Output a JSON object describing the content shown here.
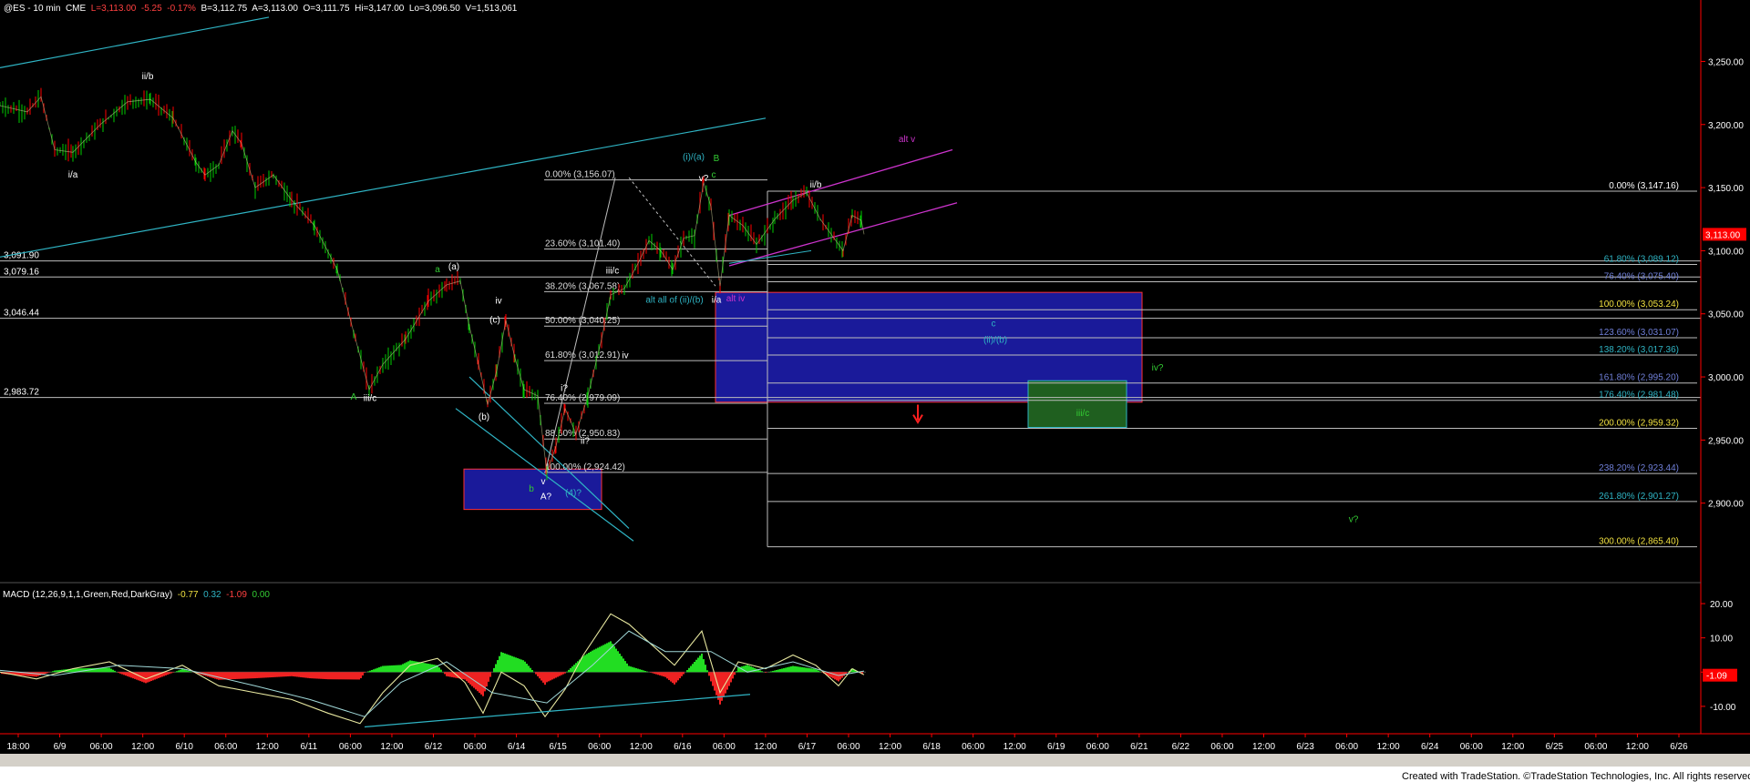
{
  "header": {
    "symbol": "@ES - 10 min  CME",
    "last": "L=3,113.00",
    "change": "-5.25",
    "pct": "-0.17%",
    "bid": "B=3,112.75",
    "ask": "A=3,113.00",
    "open": "O=3,111.75",
    "high": "Hi=3,147.00",
    "low": "Lo=3,096.50",
    "volume": "V=1,513,061"
  },
  "macd_header": {
    "label": "MACD (12,26,9,1,1,Green,Red,DarkGray)",
    "v1": "-0.77",
    "v2": "0.32",
    "v3": "-1.09",
    "v4": "0.00"
  },
  "footer": "Created with TradeStation. ©TradeStation Technologies, Inc. All rights reserved.",
  "colors": {
    "background": "#000000",
    "axis_panel": "#ffffff",
    "price_green": "#00cc00",
    "price_red": "#ff0000",
    "trend_cyan": "#2fb4c4",
    "channel_magenta": "#cc33cc",
    "box_blue": "#1a1a9a",
    "box_green": "#1f5f1f",
    "fib_line": "#bdbdbd"
  },
  "chart_data": {
    "type": "candlestick",
    "title": "",
    "price_axis": {
      "ticks": [
        "3,250.00",
        "3,200.00",
        "3,150.00",
        "3,100.00",
        "3,050.00",
        "3,000.00",
        "2,950.00",
        "2,900.00"
      ],
      "ylim": [
        2850,
        3290
      ],
      "last_price_label": "3,113.00"
    },
    "time_axis": {
      "ticks": [
        "18:00",
        "6/9",
        "06:00",
        "12:00",
        "6/10",
        "06:00",
        "12:00",
        "6/11",
        "06:00",
        "12:00",
        "6/12",
        "06:00",
        "6/14",
        "6/15",
        "06:00",
        "12:00",
        "6/16",
        "06:00",
        "12:00",
        "6/17",
        "06:00",
        "12:00",
        "6/18",
        "06:00",
        "12:00",
        "6/19",
        "06:00",
        "6/21",
        "6/22",
        "06:00",
        "12:00",
        "6/23",
        "06:00",
        "12:00",
        "6/24",
        "06:00",
        "12:00",
        "6/25",
        "06:00",
        "12:00",
        "6/26"
      ]
    },
    "price_path": [
      {
        "t": 0,
        "p": 3215
      },
      {
        "t": 30,
        "p": 3210
      },
      {
        "t": 45,
        "p": 3222
      },
      {
        "t": 60,
        "p": 3180
      },
      {
        "t": 80,
        "p": 3178
      },
      {
        "t": 110,
        "p": 3200
      },
      {
        "t": 140,
        "p": 3218
      },
      {
        "t": 165,
        "p": 3220
      },
      {
        "t": 190,
        "p": 3205
      },
      {
        "t": 215,
        "p": 3170
      },
      {
        "t": 225,
        "p": 3160
      },
      {
        "t": 240,
        "p": 3168
      },
      {
        "t": 255,
        "p": 3195
      },
      {
        "t": 265,
        "p": 3185
      },
      {
        "t": 280,
        "p": 3150
      },
      {
        "t": 300,
        "p": 3160
      },
      {
        "t": 320,
        "p": 3140
      },
      {
        "t": 345,
        "p": 3120
      },
      {
        "t": 370,
        "p": 3085
      },
      {
        "t": 390,
        "p": 3030
      },
      {
        "t": 405,
        "p": 2990
      },
      {
        "t": 420,
        "p": 3010
      },
      {
        "t": 445,
        "p": 3030
      },
      {
        "t": 470,
        "p": 3060
      },
      {
        "t": 490,
        "p": 3073
      },
      {
        "t": 505,
        "p": 3076
      },
      {
        "t": 515,
        "p": 3040
      },
      {
        "t": 525,
        "p": 3010
      },
      {
        "t": 535,
        "p": 2978
      },
      {
        "t": 545,
        "p": 3005
      },
      {
        "t": 555,
        "p": 3045
      },
      {
        "t": 565,
        "p": 3015
      },
      {
        "t": 575,
        "p": 2990
      },
      {
        "t": 590,
        "p": 2985
      },
      {
        "t": 600,
        "p": 2924
      },
      {
        "t": 610,
        "p": 2945
      },
      {
        "t": 620,
        "p": 2975
      },
      {
        "t": 632,
        "p": 2955
      },
      {
        "t": 645,
        "p": 2985
      },
      {
        "t": 660,
        "p": 3030
      },
      {
        "t": 670,
        "p": 3065
      },
      {
        "t": 685,
        "p": 3070
      },
      {
        "t": 700,
        "p": 3090
      },
      {
        "t": 712,
        "p": 3108
      },
      {
        "t": 725,
        "p": 3100
      },
      {
        "t": 738,
        "p": 3085
      },
      {
        "t": 750,
        "p": 3110
      },
      {
        "t": 762,
        "p": 3112
      },
      {
        "t": 772,
        "p": 3154
      },
      {
        "t": 780,
        "p": 3135
      },
      {
        "t": 790,
        "p": 3072
      },
      {
        "t": 800,
        "p": 3128
      },
      {
        "t": 815,
        "p": 3120
      },
      {
        "t": 830,
        "p": 3105
      },
      {
        "t": 850,
        "p": 3125
      },
      {
        "t": 870,
        "p": 3140
      },
      {
        "t": 885,
        "p": 3146
      },
      {
        "t": 900,
        "p": 3125
      },
      {
        "t": 915,
        "p": 3110
      },
      {
        "t": 925,
        "p": 3100
      },
      {
        "t": 935,
        "p": 3128
      },
      {
        "t": 945,
        "p": 3124
      },
      {
        "t": 948,
        "p": 3113
      }
    ],
    "annotations": [
      {
        "text": "i/a",
        "t": 80,
        "p": 3158,
        "color": "#ffffff"
      },
      {
        "text": "ii/b",
        "t": 162,
        "p": 3236,
        "color": "#ffffff"
      },
      {
        "text": "A",
        "t": 388,
        "p": 2982,
        "color": "#33cc33"
      },
      {
        "text": "iii/c",
        "t": 406,
        "p": 2981,
        "color": "#ffffff"
      },
      {
        "text": "a",
        "t": 480,
        "p": 3083,
        "color": "#33cc33"
      },
      {
        "text": "(a)",
        "t": 498,
        "p": 3085,
        "color": "#ffffff"
      },
      {
        "text": "iv",
        "t": 547,
        "p": 3058,
        "color": "#ffffff"
      },
      {
        "text": "(c)",
        "t": 543,
        "p": 3043,
        "color": "#ffffff"
      },
      {
        "text": "(b)",
        "t": 531,
        "p": 2966,
        "color": "#ffffff"
      },
      {
        "text": "b",
        "t": 583,
        "p": 2909,
        "color": "#33cc33"
      },
      {
        "text": "v",
        "t": 596,
        "p": 2915,
        "color": "#ffffff"
      },
      {
        "text": "A?",
        "t": 599,
        "p": 2903,
        "color": "#ffffff"
      },
      {
        "text": "(4)?",
        "t": 629,
        "p": 2906,
        "color": "#2fb4c4"
      },
      {
        "text": "i?",
        "t": 619,
        "p": 2989,
        "color": "#ffffff"
      },
      {
        "text": "ii?",
        "t": 642,
        "p": 2947,
        "color": "#ffffff"
      },
      {
        "text": "iv",
        "t": 686,
        "p": 3015,
        "color": "#ffffff"
      },
      {
        "text": "iii/c",
        "t": 672,
        "p": 3082,
        "color": "#ffffff"
      },
      {
        "text": "alt all of (ii)/(b)",
        "t": 740,
        "p": 3059,
        "color": "#2fb4c4"
      },
      {
        "text": "i/a",
        "t": 786,
        "p": 3059,
        "color": "#ffffff"
      },
      {
        "text": "alt iv",
        "t": 807,
        "p": 3060,
        "color": "#cc33cc"
      },
      {
        "text": "(i)/(a)",
        "t": 761,
        "p": 3172,
        "color": "#2fb4c4"
      },
      {
        "text": "B",
        "t": 786,
        "p": 3171,
        "color": "#33cc33"
      },
      {
        "text": "v?",
        "t": 772,
        "p": 3155,
        "color": "#ffffff"
      },
      {
        "text": "c",
        "t": 783,
        "p": 3158,
        "color": "#33cc33"
      },
      {
        "text": "ii/b",
        "t": 895,
        "p": 3150,
        "color": "#ffffff"
      },
      {
        "text": "alt v",
        "t": 995,
        "p": 3186,
        "color": "#cc33cc"
      },
      {
        "text": "c",
        "t": 1090,
        "p": 3040,
        "color": "#2fb4c4"
      },
      {
        "text": "(ii)/(b)",
        "t": 1092,
        "p": 3027,
        "color": "#2fb4c4"
      },
      {
        "text": "iv?",
        "t": 1270,
        "p": 3005,
        "color": "#33cc33"
      },
      {
        "text": "iii/c",
        "t": 1188,
        "p": 2969,
        "color": "#33cc33"
      },
      {
        "text": "v?",
        "t": 1485,
        "p": 2885,
        "color": "#33cc33"
      }
    ],
    "left_levels": [
      {
        "label": "3,091.90",
        "price": 3091.9
      },
      {
        "label": "3,079.16",
        "price": 3079.16
      },
      {
        "label": "3,046.44",
        "price": 3046.44
      },
      {
        "label": "2,983.72",
        "price": 2983.72
      }
    ],
    "fib_retracement": [
      {
        "label": "0.00% (3,156.07)",
        "price": 3156.07
      },
      {
        "label": "23.60% (3,101.40)",
        "price": 3101.4
      },
      {
        "label": "38.20% (3,067.58)",
        "price": 3067.58
      },
      {
        "label": "50.00% (3,040.25)",
        "price": 3040.25
      },
      {
        "label": "61.80% (3,012.91)",
        "price": 3012.91
      },
      {
        "label": "76.40% (2,979.09)",
        "price": 2979.09
      },
      {
        "label": "88.60% (2,950.83)",
        "price": 2950.83
      },
      {
        "label": "100.00% (2,924.42)",
        "price": 2924.42
      }
    ],
    "fib_extension": [
      {
        "label": "0.00% (3,147.16)",
        "price": 3147.16,
        "color": "#ffffff"
      },
      {
        "label": "61.80% (3,089.12)",
        "price": 3089.12,
        "color": "#2fb4c4"
      },
      {
        "label": "76.40% (3,075.40)",
        "price": 3075.4,
        "color": "#6f7fd8"
      },
      {
        "label": "100.00% (3,053.24)",
        "price": 3053.24,
        "color": "#f0e040"
      },
      {
        "label": "123.60% (3,031.07)",
        "price": 3031.07,
        "color": "#6f7fd8"
      },
      {
        "label": "138.20% (3,017.36)",
        "price": 3017.36,
        "color": "#2fb4c4"
      },
      {
        "label": "161.80% (2,995.20)",
        "price": 2995.2,
        "color": "#6f7fd8"
      },
      {
        "label": "176.40% (2,981.48)",
        "price": 2981.48,
        "color": "#2fb4c4"
      },
      {
        "label": "200.00% (2,959.32)",
        "price": 2959.32,
        "color": "#f0e040"
      },
      {
        "label": "238.20% (2,923.44)",
        "price": 2923.44,
        "color": "#6f7fd8"
      },
      {
        "label": "261.80% (2,901.27)",
        "price": 2901.27,
        "color": "#2fb4c4"
      },
      {
        "label": "300.00% (2,865.40)",
        "price": 2865.4,
        "color": "#f0e040"
      }
    ],
    "macd": {
      "ticks": [
        "20.00",
        "10.00",
        "0.00",
        "-10.00"
      ],
      "ylim": [
        -18,
        24
      ],
      "last_value_label": "-1.09",
      "macd_line": [
        {
          "t": 0,
          "v": 0
        },
        {
          "t": 40,
          "v": -2
        },
        {
          "t": 80,
          "v": 1
        },
        {
          "t": 120,
          "v": 3
        },
        {
          "t": 160,
          "v": -2
        },
        {
          "t": 200,
          "v": 2
        },
        {
          "t": 240,
          "v": -4
        },
        {
          "t": 280,
          "v": -6
        },
        {
          "t": 320,
          "v": -8
        },
        {
          "t": 360,
          "v": -12
        },
        {
          "t": 395,
          "v": -15
        },
        {
          "t": 420,
          "v": -6
        },
        {
          "t": 450,
          "v": 2
        },
        {
          "t": 480,
          "v": 4
        },
        {
          "t": 510,
          "v": -3
        },
        {
          "t": 530,
          "v": -12
        },
        {
          "t": 550,
          "v": 0
        },
        {
          "t": 575,
          "v": -4
        },
        {
          "t": 598,
          "v": -13
        },
        {
          "t": 620,
          "v": -5
        },
        {
          "t": 640,
          "v": 5
        },
        {
          "t": 670,
          "v": 17
        },
        {
          "t": 690,
          "v": 14
        },
        {
          "t": 715,
          "v": 8
        },
        {
          "t": 740,
          "v": 2
        },
        {
          "t": 770,
          "v": 12
        },
        {
          "t": 790,
          "v": -6
        },
        {
          "t": 810,
          "v": 3
        },
        {
          "t": 840,
          "v": 1
        },
        {
          "t": 870,
          "v": 5
        },
        {
          "t": 895,
          "v": 2
        },
        {
          "t": 920,
          "v": -4
        },
        {
          "t": 935,
          "v": 1
        },
        {
          "t": 948,
          "v": -0.77
        }
      ],
      "signal_line": [
        {
          "t": 0,
          "v": 0.5
        },
        {
          "t": 60,
          "v": -1
        },
        {
          "t": 130,
          "v": 2
        },
        {
          "t": 200,
          "v": 1
        },
        {
          "t": 280,
          "v": -4
        },
        {
          "t": 340,
          "v": -8
        },
        {
          "t": 400,
          "v": -13
        },
        {
          "t": 440,
          "v": -3
        },
        {
          "t": 490,
          "v": 3
        },
        {
          "t": 540,
          "v": -6
        },
        {
          "t": 600,
          "v": -9
        },
        {
          "t": 650,
          "v": 2
        },
        {
          "t": 690,
          "v": 12
        },
        {
          "t": 730,
          "v": 6
        },
        {
          "t": 780,
          "v": 6
        },
        {
          "t": 820,
          "v": 0
        },
        {
          "t": 870,
          "v": 3
        },
        {
          "t": 920,
          "v": -1
        },
        {
          "t": 948,
          "v": 0.32
        }
      ],
      "divergence_line": {
        "t0": 400,
        "v0": -16,
        "t1": 823,
        "v1": -6.5
      }
    }
  }
}
